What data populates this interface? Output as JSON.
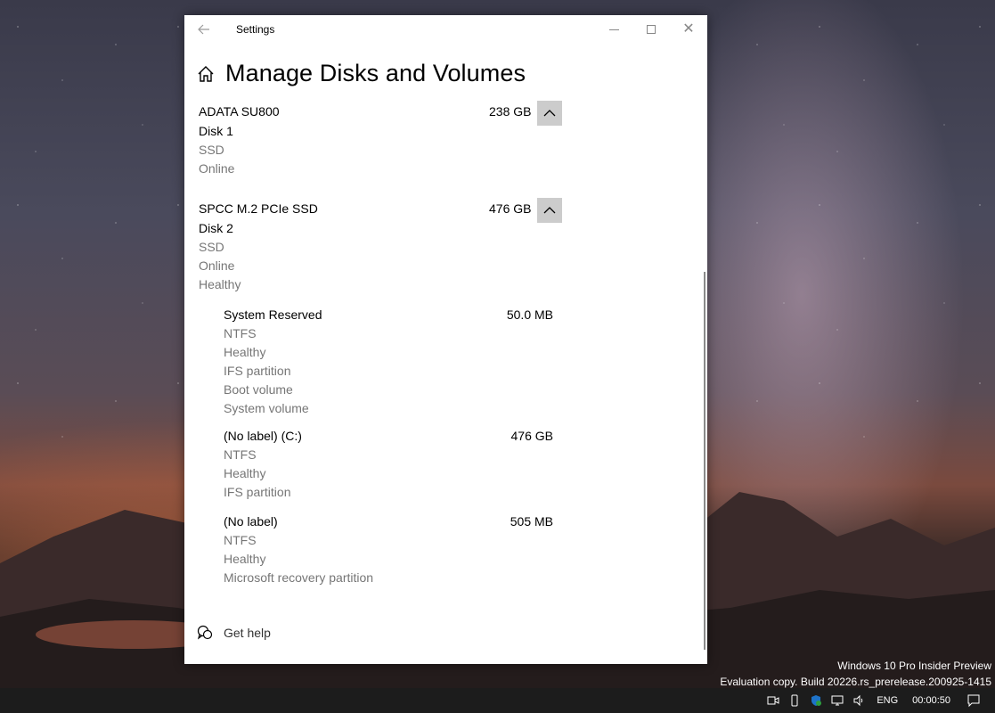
{
  "window": {
    "title": "Settings",
    "page_title": "Manage Disks and Volumes"
  },
  "disks": [
    {
      "name": "ADATA SU800",
      "size": "238 GB",
      "label": "Disk 1",
      "details": [
        "SSD",
        "Online"
      ]
    },
    {
      "name": "SPCC M.2 PCIe SSD",
      "size": "476 GB",
      "label": "Disk 2",
      "details": [
        "SSD",
        "Online",
        "Healthy"
      ]
    }
  ],
  "volumes": [
    {
      "name": "System Reserved",
      "size": "50.0 MB",
      "details": [
        "NTFS",
        "Healthy",
        "IFS partition",
        "Boot volume",
        "System volume"
      ]
    },
    {
      "name": "(No label) (C:)",
      "size": "476 GB",
      "details": [
        "NTFS",
        "Healthy",
        "IFS partition"
      ]
    },
    {
      "name": "(No label)",
      "size": "505 MB",
      "details": [
        "NTFS",
        "Healthy",
        "Microsoft recovery partition"
      ]
    }
  ],
  "help": {
    "label": "Get help"
  },
  "watermark": {
    "line1": "Windows 10 Pro Insider Preview",
    "line2": "Evaluation copy. Build 20226.rs_prerelease.200925-1415"
  },
  "taskbar": {
    "language": "ENG",
    "clock": "00:00:50"
  }
}
